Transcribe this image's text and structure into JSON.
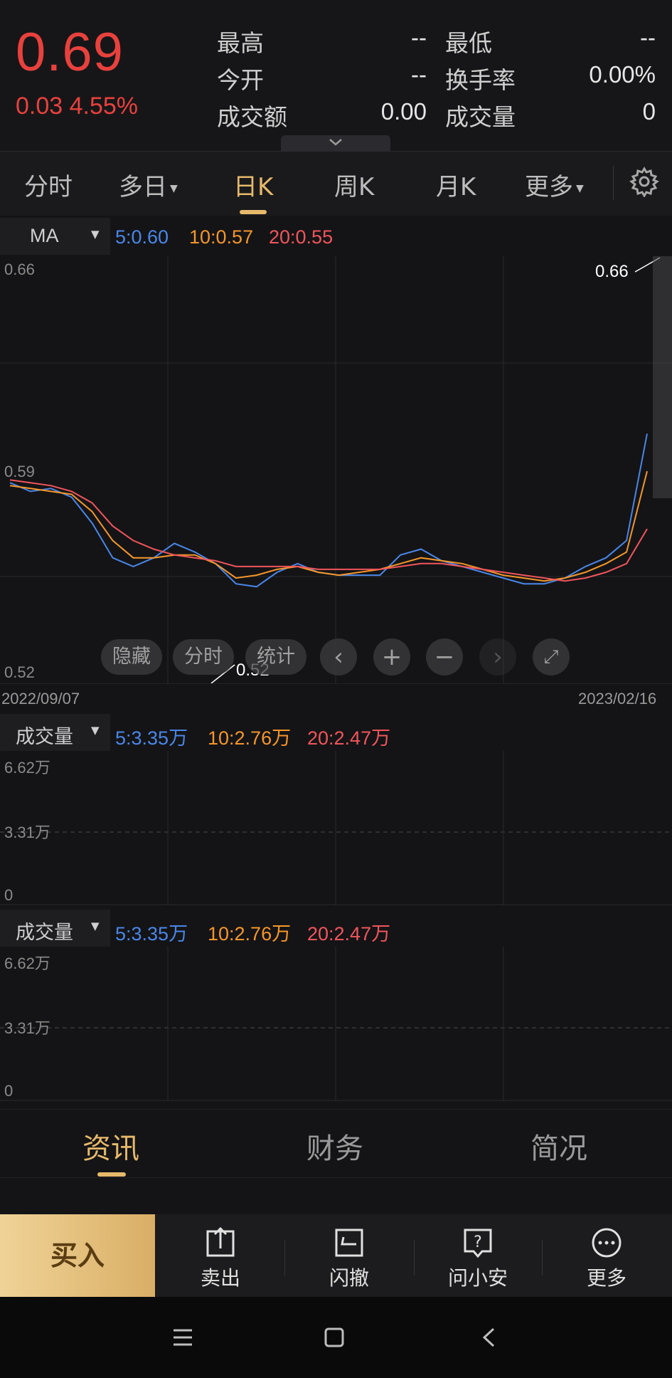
{
  "quote": {
    "price": "0.69",
    "change": "0.03 4.55%",
    "fields": [
      {
        "label": "最高",
        "value": "--"
      },
      {
        "label": "最低",
        "value": "--"
      },
      {
        "label": "今开",
        "value": "--"
      },
      {
        "label": "换手率",
        "value": "0.00%"
      },
      {
        "label": "成交额",
        "value": "0.00"
      },
      {
        "label": "成交量",
        "value": "0"
      }
    ],
    "up_color": "#e8413d"
  },
  "tabs": [
    {
      "label": "分时"
    },
    {
      "label": "多日"
    },
    {
      "label": "日K"
    },
    {
      "label": "周K"
    },
    {
      "label": "月K"
    },
    {
      "label": "更多"
    }
  ],
  "active_tab": "日K",
  "ma_bar": {
    "indicator": "MA",
    "ma5": "5:0.60",
    "ma10": "10:0.57",
    "ma20": "20:0.55",
    "colors": {
      "ma5": "#4a86e8",
      "ma10": "#f5962a",
      "ma20": "#f0555b"
    }
  },
  "kline": {
    "y_top": "0.66",
    "y_mid": "0.59",
    "y_bottom": "0.52",
    "high_marker": "0.66",
    "low_marker": "0.52",
    "date_start": "2022/09/07",
    "date_end": "2023/02/16",
    "overlay_buttons": [
      "隐藏",
      "分时",
      "统计"
    ]
  },
  "volume_panels": [
    {
      "indicator": "成交量",
      "ma5": "5:3.35万",
      "ma10": "10:2.76万",
      "ma20": "20:2.47万",
      "y_top": "6.62万",
      "y_mid": "3.31万",
      "y_bottom": "0"
    },
    {
      "indicator": "成交量",
      "ma5": "5:3.35万",
      "ma10": "10:2.76万",
      "ma20": "20:2.47万",
      "y_top": "6.62万",
      "y_mid": "3.31万",
      "y_bottom": "0"
    }
  ],
  "info_tabs": [
    {
      "label": "资讯"
    },
    {
      "label": "财务"
    },
    {
      "label": "简况"
    }
  ],
  "actions": {
    "buy": "买入",
    "sell": "卖出",
    "cancel": "闪撤",
    "ask": "问小安",
    "more": "更多"
  },
  "chart_data": {
    "type": "line",
    "title": "",
    "xlabel": "",
    "ylabel": "",
    "x_range": [
      "2022/09/07",
      "2023/02/16"
    ],
    "ylim": [
      0.52,
      0.66
    ],
    "series": [
      {
        "name": "5",
        "values": [
          0.586,
          0.583,
          0.584,
          0.581,
          0.572,
          0.56,
          0.557,
          0.56,
          0.565,
          0.562,
          0.558,
          0.551,
          0.55,
          0.555,
          0.558,
          0.555,
          0.554,
          0.554,
          0.554,
          0.561,
          0.563,
          0.559,
          0.557,
          0.555,
          0.553,
          0.551,
          0.551,
          0.553,
          0.557,
          0.56,
          0.566,
          0.603
        ]
      },
      {
        "name": "10",
        "values": [
          0.585,
          0.584,
          0.583,
          0.582,
          0.576,
          0.566,
          0.56,
          0.56,
          0.561,
          0.561,
          0.558,
          0.553,
          0.554,
          0.556,
          0.557,
          0.555,
          0.554,
          0.555,
          0.556,
          0.558,
          0.56,
          0.559,
          0.558,
          0.556,
          0.554,
          0.553,
          0.552,
          0.553,
          0.555,
          0.558,
          0.562,
          0.59
        ]
      },
      {
        "name": "20",
        "values": [
          0.587,
          0.586,
          0.585,
          0.583,
          0.579,
          0.571,
          0.566,
          0.563,
          0.561,
          0.56,
          0.559,
          0.557,
          0.557,
          0.557,
          0.557,
          0.556,
          0.556,
          0.556,
          0.556,
          0.557,
          0.558,
          0.558,
          0.557,
          0.556,
          0.555,
          0.554,
          0.553,
          0.552,
          0.553,
          0.555,
          0.558,
          0.57
        ]
      }
    ],
    "volume_ylim": [
      0,
      6.62
    ],
    "volume_unit": "万"
  }
}
